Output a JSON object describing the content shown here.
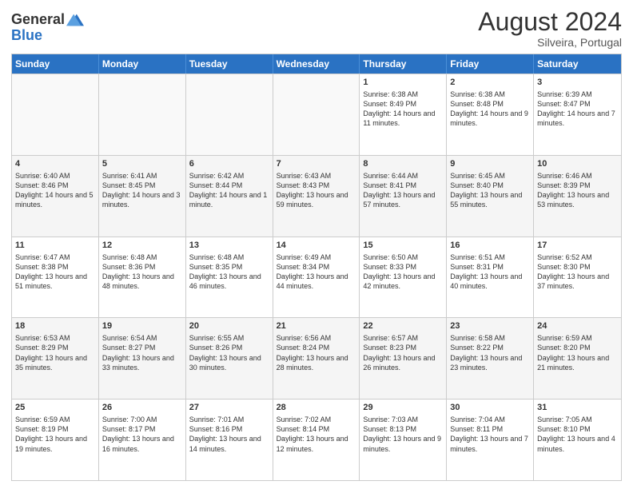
{
  "header": {
    "logo_line1": "General",
    "logo_line2": "Blue",
    "month_year": "August 2024",
    "location": "Silveira, Portugal"
  },
  "weekdays": [
    "Sunday",
    "Monday",
    "Tuesday",
    "Wednesday",
    "Thursday",
    "Friday",
    "Saturday"
  ],
  "weeks": [
    [
      {
        "day": "",
        "text": "",
        "empty": true
      },
      {
        "day": "",
        "text": "",
        "empty": true
      },
      {
        "day": "",
        "text": "",
        "empty": true
      },
      {
        "day": "",
        "text": "",
        "empty": true
      },
      {
        "day": "1",
        "text": "Sunrise: 6:38 AM\nSunset: 8:49 PM\nDaylight: 14 hours and 11 minutes."
      },
      {
        "day": "2",
        "text": "Sunrise: 6:38 AM\nSunset: 8:48 PM\nDaylight: 14 hours and 9 minutes."
      },
      {
        "day": "3",
        "text": "Sunrise: 6:39 AM\nSunset: 8:47 PM\nDaylight: 14 hours and 7 minutes."
      }
    ],
    [
      {
        "day": "4",
        "text": "Sunrise: 6:40 AM\nSunset: 8:46 PM\nDaylight: 14 hours and 5 minutes."
      },
      {
        "day": "5",
        "text": "Sunrise: 6:41 AM\nSunset: 8:45 PM\nDaylight: 14 hours and 3 minutes."
      },
      {
        "day": "6",
        "text": "Sunrise: 6:42 AM\nSunset: 8:44 PM\nDaylight: 14 hours and 1 minute."
      },
      {
        "day": "7",
        "text": "Sunrise: 6:43 AM\nSunset: 8:43 PM\nDaylight: 13 hours and 59 minutes."
      },
      {
        "day": "8",
        "text": "Sunrise: 6:44 AM\nSunset: 8:41 PM\nDaylight: 13 hours and 57 minutes."
      },
      {
        "day": "9",
        "text": "Sunrise: 6:45 AM\nSunset: 8:40 PM\nDaylight: 13 hours and 55 minutes."
      },
      {
        "day": "10",
        "text": "Sunrise: 6:46 AM\nSunset: 8:39 PM\nDaylight: 13 hours and 53 minutes."
      }
    ],
    [
      {
        "day": "11",
        "text": "Sunrise: 6:47 AM\nSunset: 8:38 PM\nDaylight: 13 hours and 51 minutes."
      },
      {
        "day": "12",
        "text": "Sunrise: 6:48 AM\nSunset: 8:36 PM\nDaylight: 13 hours and 48 minutes."
      },
      {
        "day": "13",
        "text": "Sunrise: 6:48 AM\nSunset: 8:35 PM\nDaylight: 13 hours and 46 minutes."
      },
      {
        "day": "14",
        "text": "Sunrise: 6:49 AM\nSunset: 8:34 PM\nDaylight: 13 hours and 44 minutes."
      },
      {
        "day": "15",
        "text": "Sunrise: 6:50 AM\nSunset: 8:33 PM\nDaylight: 13 hours and 42 minutes."
      },
      {
        "day": "16",
        "text": "Sunrise: 6:51 AM\nSunset: 8:31 PM\nDaylight: 13 hours and 40 minutes."
      },
      {
        "day": "17",
        "text": "Sunrise: 6:52 AM\nSunset: 8:30 PM\nDaylight: 13 hours and 37 minutes."
      }
    ],
    [
      {
        "day": "18",
        "text": "Sunrise: 6:53 AM\nSunset: 8:29 PM\nDaylight: 13 hours and 35 minutes."
      },
      {
        "day": "19",
        "text": "Sunrise: 6:54 AM\nSunset: 8:27 PM\nDaylight: 13 hours and 33 minutes."
      },
      {
        "day": "20",
        "text": "Sunrise: 6:55 AM\nSunset: 8:26 PM\nDaylight: 13 hours and 30 minutes."
      },
      {
        "day": "21",
        "text": "Sunrise: 6:56 AM\nSunset: 8:24 PM\nDaylight: 13 hours and 28 minutes."
      },
      {
        "day": "22",
        "text": "Sunrise: 6:57 AM\nSunset: 8:23 PM\nDaylight: 13 hours and 26 minutes."
      },
      {
        "day": "23",
        "text": "Sunrise: 6:58 AM\nSunset: 8:22 PM\nDaylight: 13 hours and 23 minutes."
      },
      {
        "day": "24",
        "text": "Sunrise: 6:59 AM\nSunset: 8:20 PM\nDaylight: 13 hours and 21 minutes."
      }
    ],
    [
      {
        "day": "25",
        "text": "Sunrise: 6:59 AM\nSunset: 8:19 PM\nDaylight: 13 hours and 19 minutes."
      },
      {
        "day": "26",
        "text": "Sunrise: 7:00 AM\nSunset: 8:17 PM\nDaylight: 13 hours and 16 minutes."
      },
      {
        "day": "27",
        "text": "Sunrise: 7:01 AM\nSunset: 8:16 PM\nDaylight: 13 hours and 14 minutes."
      },
      {
        "day": "28",
        "text": "Sunrise: 7:02 AM\nSunset: 8:14 PM\nDaylight: 13 hours and 12 minutes."
      },
      {
        "day": "29",
        "text": "Sunrise: 7:03 AM\nSunset: 8:13 PM\nDaylight: 13 hours and 9 minutes."
      },
      {
        "day": "30",
        "text": "Sunrise: 7:04 AM\nSunset: 8:11 PM\nDaylight: 13 hours and 7 minutes."
      },
      {
        "day": "31",
        "text": "Sunrise: 7:05 AM\nSunset: 8:10 PM\nDaylight: 13 hours and 4 minutes."
      }
    ]
  ]
}
